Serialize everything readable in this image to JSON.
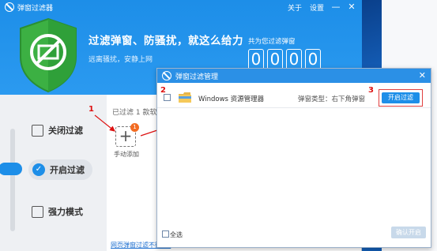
{
  "app": {
    "name": "弹窗过滤器",
    "menu": {
      "about": "关于",
      "settings": "设置"
    },
    "window_controls": {
      "minimize": "—",
      "close": "✕"
    },
    "headline": "过滤弹窗、防骚扰，就这么给力",
    "subline": "远离骚扰，安静上网",
    "counter_label": "共为您过滤弹窗",
    "counter_digits": [
      "0",
      "0",
      "0",
      "0"
    ]
  },
  "sidebar": {
    "items": [
      {
        "label": "关闭过滤",
        "icon": "checkbox-icon"
      },
      {
        "label": "开启过滤",
        "icon": "check-circle-icon"
      },
      {
        "label": "强力模式",
        "icon": "window-icon"
      }
    ]
  },
  "content": {
    "filtered_text": "已过滤 1 款软",
    "add_button_symbol": "+",
    "add_badge": "1",
    "add_label": "手动添加",
    "bottom_link": "网页弹窗过滤不彻底?"
  },
  "annotations": {
    "step1": "1",
    "step2": "2",
    "step3": "3",
    "accent": "#dd1111"
  },
  "dialog": {
    "title": "弹窗过滤管理",
    "close": "✕",
    "rows": [
      {
        "name": "Windows 资源管理器",
        "popup_type": "弹窗类型：右下角弹窗",
        "action": "开启过滤"
      }
    ],
    "select_all": "全选",
    "confirm": "确认开启"
  },
  "colors": {
    "primary": "#1d8ee8",
    "badge": "#f26b22",
    "confirm_disabled": "#c8d9ea"
  }
}
